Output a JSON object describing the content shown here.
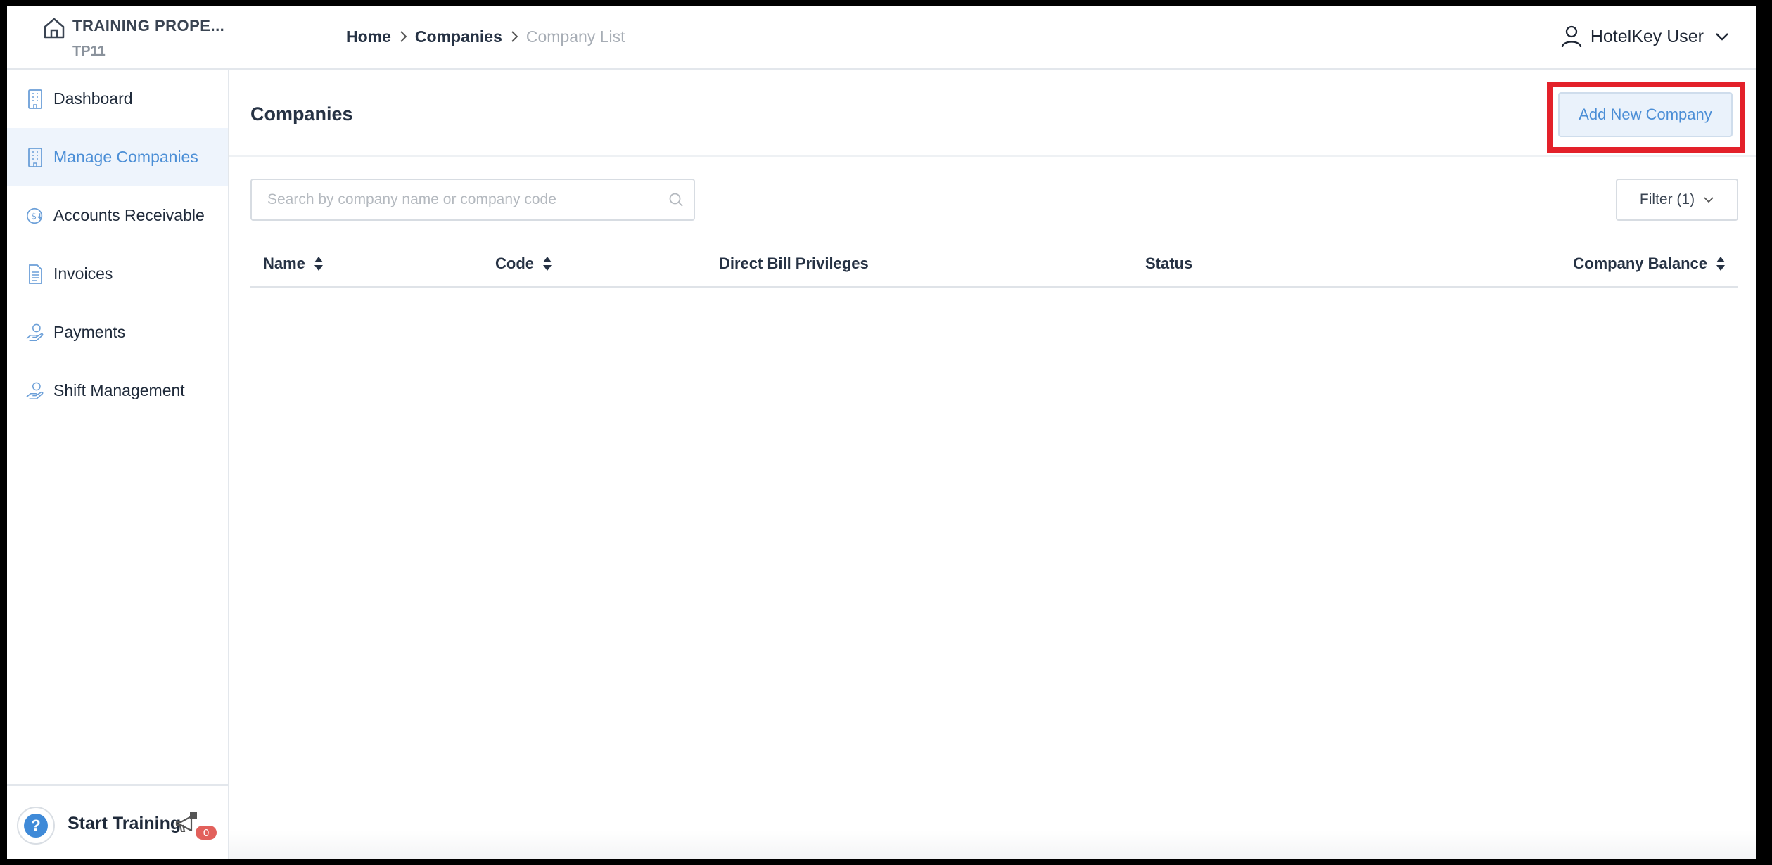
{
  "header": {
    "property_name": "TRAINING PROPE...",
    "property_code": "TP11",
    "breadcrumb": [
      "Home",
      "Companies",
      "Company List"
    ],
    "user_name": "HotelKey User"
  },
  "sidebar": {
    "items": [
      {
        "label": "Dashboard",
        "icon": "building-icon",
        "active": false
      },
      {
        "label": "Manage Companies",
        "icon": "building-icon",
        "active": true
      },
      {
        "label": "Accounts Receivable",
        "icon": "dollar-circle-icon",
        "active": false
      },
      {
        "label": "Invoices",
        "icon": "document-icon",
        "active": false
      },
      {
        "label": "Payments",
        "icon": "hand-coin-icon",
        "active": false
      },
      {
        "label": "Shift Management",
        "icon": "hand-coin-icon",
        "active": false
      }
    ],
    "bottom": {
      "help_glyph": "?",
      "start_training": "Start Training",
      "badge_count": "0"
    }
  },
  "main": {
    "title": "Companies",
    "add_button": "Add New Company",
    "search_placeholder": "Search by company name or company code",
    "filter_label": "Filter (1)",
    "columns": [
      {
        "label": "Name",
        "sortable": true
      },
      {
        "label": "Code",
        "sortable": true
      },
      {
        "label": "Direct Bill Privileges",
        "sortable": false
      },
      {
        "label": "Status",
        "sortable": false
      },
      {
        "label": "Company Balance",
        "sortable": true
      }
    ],
    "rows": []
  },
  "colors": {
    "accent": "#4b8ed6",
    "active_bg": "#eef4fc",
    "highlight_box": "#e3212a",
    "badge": "#e2605b"
  }
}
